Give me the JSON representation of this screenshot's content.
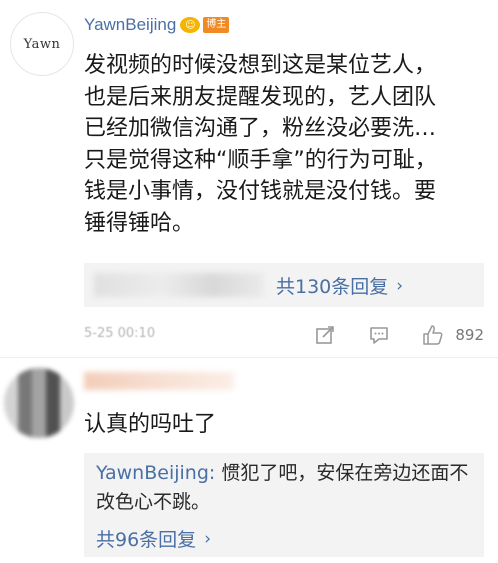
{
  "comment1": {
    "avatar_text": "Yawn",
    "username": "YawnBeijing",
    "badge": "博主",
    "text": "发视频的时候没想到这是某位艺人，\n也是后来朋友提醒发现的，艺人团队\n已经加微信沟通了，粉丝没必要洗…\n只是觉得这种“顺手拿”的行为可耻，\n钱是小事情，没付钱就是没付钱。要\n锤得锤哈。",
    "reply_link": "共130条回复",
    "time": "5-25 00:10",
    "like_count": "892",
    "icons": [
      "share-icon",
      "comment-icon",
      "like-icon"
    ]
  },
  "comment2": {
    "text": "认真的吗吐了",
    "reply": {
      "username": "YawnBeijing:",
      "text": " 惯犯了吧，安保在旁边还面不改色心不跳。"
    },
    "reply_link": "共96条回复"
  },
  "colors": {
    "link": "#4a6fa5",
    "badge": "#f08a24",
    "reply_bg": "#f3f3f3"
  }
}
